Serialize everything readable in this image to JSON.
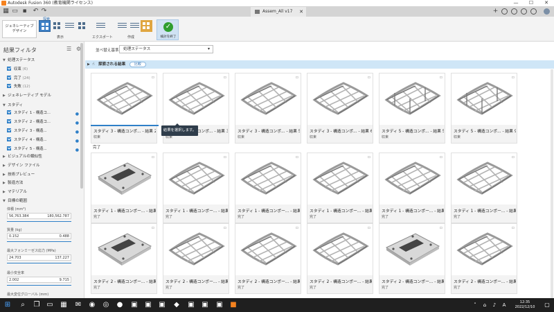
{
  "window": {
    "title": "Autodesk Fusion 360 (教育機関ライセンス)",
    "controls": [
      "—",
      "☐",
      "✕"
    ]
  },
  "doctab": {
    "title": "Assem_All v17",
    "close": "✕"
  },
  "ribbon": {
    "workspace": "ジェネレーティブ デザイン",
    "group_display": "表示",
    "group_explore": "探索",
    "export_label": "エクスポート",
    "create_label": "作成",
    "finish_label": "検討を終了"
  },
  "filter_panel": {
    "title": "結果フィルタ",
    "sections": {
      "status": "処理ステータス",
      "gen_model": "ジェネレーティブ モデル",
      "study": "スタディ",
      "visual": "ビジュアルの類似性",
      "design_file": "デザイン ファイル",
      "tech_preview": "技術プレビュー",
      "manufacturing": "製造方法",
      "material": "マテリアル",
      "goals": "目標の範囲"
    },
    "status_items": [
      {
        "label": "収束",
        "count": "(6)"
      },
      {
        "label": "完了",
        "count": "(24)"
      },
      {
        "label": "失敗",
        "count": "(12)"
      }
    ],
    "study_items": [
      {
        "label": "スタディ 1 - 構造コ..."
      },
      {
        "label": "スタディ 2 - 構造コ..."
      },
      {
        "label": "スタディ 3 - 構造..."
      },
      {
        "label": "スタディ 4 - 構造..."
      },
      {
        "label": "スタディ 5 - 構造..."
      }
    ],
    "ranges": [
      {
        "label": "体積 (mm³)",
        "min": "56,763.384",
        "max": "180,562.787"
      },
      {
        "label": "質量 (kg)",
        "min": "0.152",
        "max": "0.488"
      },
      {
        "label": "最大フォンミーゼス応力 (MPa)",
        "min": "24.703",
        "max": "137.227"
      },
      {
        "label": "最小安全率",
        "min": "2.002",
        "max": "9.715"
      },
      {
        "label": "最大変位グローバル (mm)",
        "min": "",
        "max": ""
      }
    ]
  },
  "main": {
    "sort_label": "並べ替え基準",
    "sort_value": "処理ステータス",
    "compare_title": "探索される結果",
    "compare_button": "比較",
    "section_done": "完了",
    "tooltip": "結果を選択します。",
    "converged_cards": [
      {
        "title": "スタディ 3 - 構造コンポ... - 結果 2",
        "status": "収束"
      },
      {
        "title": "スタディ 3 - 構造コンポ... - 結果 3",
        "status": "収束"
      },
      {
        "title": "スタディ 3 - 構造コンポ... - 結果 5",
        "status": "収束"
      },
      {
        "title": "スタディ 3 - 構造コンポ... - 結果 6",
        "status": "収束"
      },
      {
        "title": "スタディ 5 - 構造コンポ... - 結果 5",
        "status": "収束"
      },
      {
        "title": "スタディ 5 - 構造コンポ... - 結果 9",
        "status": "収束"
      }
    ],
    "done_row1": [
      {
        "title": "スタディ 1 - 構造コンポー... - 結果 1",
        "status": "完了"
      },
      {
        "title": "スタディ 1 - 構造コンポー... - 結果 2",
        "status": "完了"
      },
      {
        "title": "スタディ 1 - 構造コンポー... - 結果 3",
        "status": "完了"
      },
      {
        "title": "スタディ 1 - 構造コンポー... - 結果 4",
        "status": "完了"
      },
      {
        "title": "スタディ 1 - 構造コンポー... - 結果 5",
        "status": "完了"
      },
      {
        "title": "スタディ 1 - 構造コンポー... - 結果 6",
        "status": "完了"
      }
    ],
    "done_row2": [
      {
        "title": "スタディ 2 - 構造コンポー... - 結果 1",
        "status": "完了"
      },
      {
        "title": "スタディ 2 - 構造コンポー... - 結果 2",
        "status": "完了"
      },
      {
        "title": "スタディ 2 - 構造コンポー... - 結果 3",
        "status": "完了"
      },
      {
        "title": "スタディ 2 - 構造コンポー... - 結果 4",
        "status": "完了"
      },
      {
        "title": "スタディ 2 - 構造コンポー... - 結果 5",
        "status": "完了"
      },
      {
        "title": "スタディ 2 - 構造コンポー... - 結果 6",
        "status": "完了"
      }
    ]
  },
  "taskbar": {
    "time": "12:35",
    "date": "2022/12/10"
  },
  "colors": {
    "accent": "#2f80c8",
    "ribbon_selected": "#3d7fc4",
    "finish_check": "#2f9e2f",
    "taskbar": "#1f1f1f"
  }
}
